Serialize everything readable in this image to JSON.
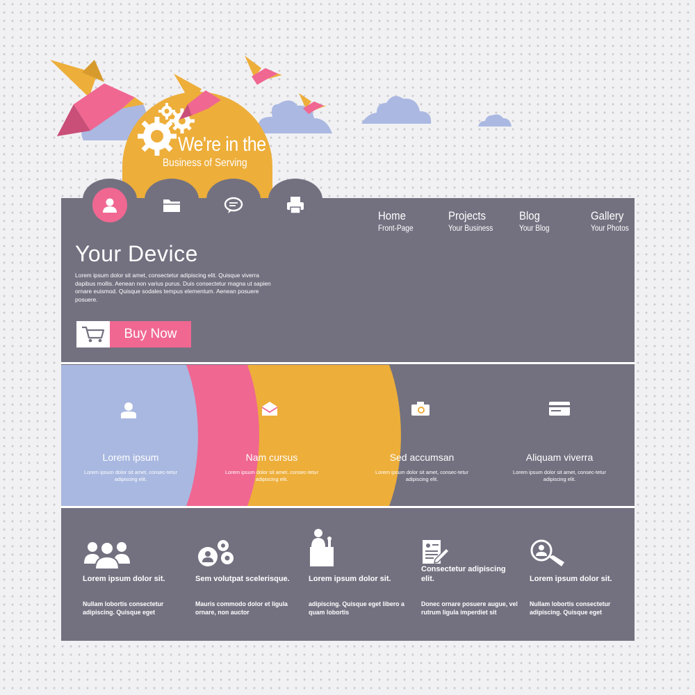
{
  "tagline": {
    "line1": "We're in the",
    "line2": "Business of Serving"
  },
  "tabs": [
    {
      "icon": "user-icon",
      "active": true
    },
    {
      "icon": "folder-icon",
      "active": false
    },
    {
      "icon": "chat-bubble-icon",
      "active": false
    },
    {
      "icon": "printer-icon",
      "active": false
    }
  ],
  "nav": [
    {
      "title": "Home",
      "subtitle": "Front-Page"
    },
    {
      "title": "Projects",
      "subtitle": "Your Business"
    },
    {
      "title": "Blog",
      "subtitle": "Your Blog"
    },
    {
      "title": "Gallery",
      "subtitle": "Your Photos"
    }
  ],
  "hero": {
    "title": "Your Device",
    "text": "Lorem ipsum dolor sit amet, consectetur adipiscing elit. Quisque viverra dapibus mollis. Aenean non varius purus. Duis consectetur magna ut sapien ornare euismod. Quisque sodales tempus elementum. Aenean posuere posuere.",
    "buy_label": "Buy Now",
    "buy_icon": "cart-icon"
  },
  "features": [
    {
      "icon": "user-icon",
      "title": "Lorem ipsum",
      "text": "Lorem ipsum dolor sit amet, consec-tetur adipiscing elit.",
      "color": "#a9b8e0"
    },
    {
      "icon": "envelope-icon",
      "title": "Nam cursus",
      "text": "Lorem ipsum dolor sit amet, consec-tetur adipiscing elit.",
      "color": "#f06792"
    },
    {
      "icon": "camera-icon",
      "title": "Sed accumsan",
      "text": "Lorem ipsum dolor sit amet, consec-tetur adipiscing elit.",
      "color": "#edae3a"
    },
    {
      "icon": "credit-card-icon",
      "title": "Aliquam viverra",
      "text": "Lorem ipsum dolor sit amet, consec-tetur adipiscing elit.",
      "color": "#737180"
    }
  ],
  "services": [
    {
      "icon": "group-icon",
      "title": "Lorem ipsum dolor sit.",
      "text": "Nullam lobortis consectetur adipiscing. Quisque eget"
    },
    {
      "icon": "user-gears-icon",
      "title": "Sem volutpat scelerisque.",
      "text": "Mauris commodo dolor et ligula ornare, non auctor"
    },
    {
      "icon": "speaker-podium-icon",
      "title": "Lorem ipsum dolor sit.",
      "text": "adipiscing. Quisque eget libero a quam lobortis"
    },
    {
      "icon": "document-pen-icon",
      "title": "Consectetur adipiscing elit.",
      "text": "Donec ornare posuere augue, vel rutrum ligula imperdiet sit"
    },
    {
      "icon": "user-search-icon",
      "title": "Lorem ipsum dolor sit.",
      "text": "Nullam lobortis consectetur adipiscing. Quisque eget"
    }
  ],
  "colors": {
    "panel": "#737180",
    "pink": "#f06792",
    "yellow": "#edae3a",
    "blue": "#a9b8e0",
    "white": "#ffffff"
  }
}
